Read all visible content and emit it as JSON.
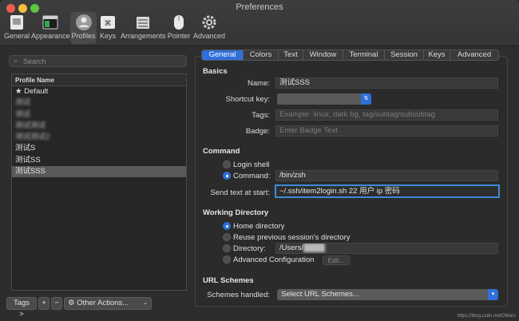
{
  "window": {
    "title": "Preferences"
  },
  "toolbar": {
    "items": [
      {
        "label": "General",
        "icon": "general-icon"
      },
      {
        "label": "Appearance",
        "icon": "appearance-icon"
      },
      {
        "label": "Profiles",
        "icon": "profiles-icon",
        "active": true
      },
      {
        "label": "Keys",
        "icon": "keys-icon"
      },
      {
        "label": "Arrangements",
        "icon": "arrangements-icon"
      },
      {
        "label": "Pointer",
        "icon": "pointer-icon"
      },
      {
        "label": "Advanced",
        "icon": "gear-icon"
      }
    ]
  },
  "search": {
    "placeholder": "Search"
  },
  "profiles": {
    "header": "Profile Name",
    "items": [
      {
        "label": "★ Default"
      },
      {
        "label": "测试"
      },
      {
        "label": "测试"
      },
      {
        "label": "测试测试"
      },
      {
        "label": "测试测试2"
      },
      {
        "label": "测试S"
      },
      {
        "label": "测试SS"
      },
      {
        "label": "测试SSS",
        "selected": true
      }
    ]
  },
  "left_bar": {
    "tags": "Tags >",
    "add": "+",
    "remove": "−",
    "other_actions": "Other Actions..."
  },
  "tabs": [
    "General",
    "Colors",
    "Text",
    "Window",
    "Terminal",
    "Session",
    "Keys",
    "Advanced"
  ],
  "basics": {
    "heading": "Basics",
    "name_label": "Name:",
    "name_value": "测试SSS",
    "shortcut_label": "Shortcut key:",
    "tags_label": "Tags:",
    "tags_placeholder": "Example: linux, dark bg, tag/subtag/subsubtag",
    "badge_label": "Badge:",
    "badge_placeholder": "Enter Badge Text"
  },
  "command": {
    "heading": "Command",
    "login_shell": "Login shell",
    "command_label": "Command:",
    "command_value": "/bin/zsh",
    "send_text_label": "Send text at start:",
    "send_text_value": "~/.ssh/item2login.sh 22 用户 ip 密码"
  },
  "working_directory": {
    "heading": "Working Directory",
    "home": "Home directory",
    "reuse": "Reuse previous session's directory",
    "directory_label": "Directory:",
    "directory_value": "/Users/",
    "advanced": "Advanced Configuration",
    "edit": "Edit..."
  },
  "url_schemes": {
    "heading": "URL Schemes",
    "handled_label": "Schemes handled:",
    "select": "Select URL Schemes..."
  },
  "watermark": "https://blog.csdn.net/OMars",
  "colors": {
    "accent": "#2f6fd9",
    "background": "#2d2d2d",
    "focus_ring": "#3a8bd6"
  }
}
